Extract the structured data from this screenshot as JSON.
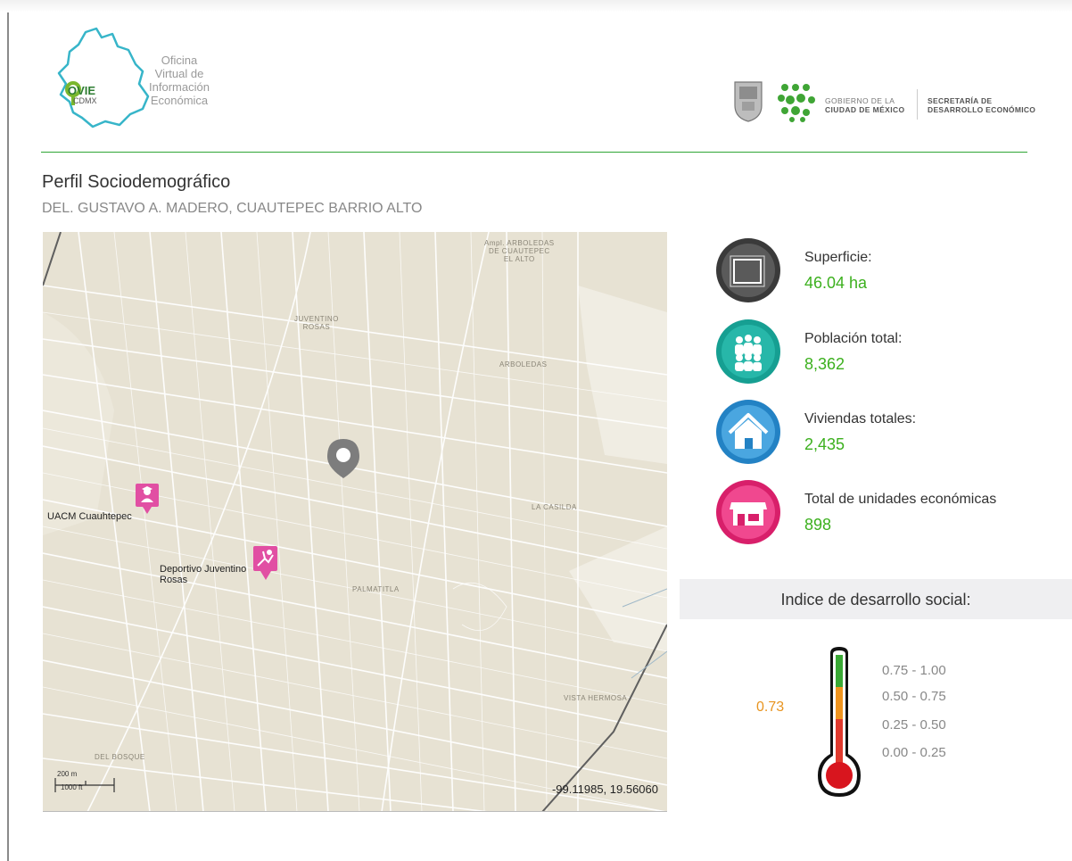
{
  "header": {
    "ovie": {
      "badge_word": "OVIE",
      "badge_sub": "CDMX",
      "lines": [
        "Oficina",
        "Virtual de",
        "Información",
        "Económica"
      ]
    },
    "gov": {
      "line1": "GOBIERNO DE LA",
      "line2": "CIUDAD DE MÉXICO",
      "secretaria_line1": "SECRETARÍA DE",
      "secretaria_line2": "DESARROLLO ECONÓMICO"
    }
  },
  "page": {
    "title": "Perfil Sociodemográfico",
    "subtitle": "DEL. GUSTAVO A. MADERO, CUAUTEPEC BARRIO ALTO"
  },
  "map": {
    "area_labels": {
      "arboledas_cuautepec": [
        "Ampl. ARBOLEDAS",
        "DE CUAUTEPEC",
        "EL ALTO"
      ],
      "juventino": [
        "JUVENTINO",
        "ROSAS"
      ],
      "arboledas": "ARBOLEDAS",
      "la_casilda": "LA CASILDA",
      "palmatitla": "PALMATITLA",
      "vista_hermosa": "VISTA HERMOSA",
      "del_bosque": "DEL BOSQUE"
    },
    "pois": {
      "uacm": "UACM Cuauhtepec",
      "deportivo_line1": "Deportivo Juventino",
      "deportivo_line2": "Rosas"
    },
    "scale_metric": "200 m",
    "scale_imperial": "1000 ft",
    "coordinates": "-99.11985, 19.56060",
    "colors": {
      "land": "#e7e2d3",
      "street": "#ffffff",
      "poi": "#e14fa3",
      "marker": "#7d7d7d"
    }
  },
  "stats": {
    "superficie": {
      "label": "Superficie:",
      "value": "46.04 ha",
      "icon": "area-icon",
      "color": "#444444"
    },
    "poblacion": {
      "label": "Población total:",
      "value": "8,362",
      "icon": "people-icon",
      "color": "#1fa99b"
    },
    "viviendas": {
      "label": "Viviendas totales:",
      "value": "2,435",
      "icon": "house-icon",
      "color": "#2f8fd0"
    },
    "unidades": {
      "label": "Total de unidades económicas",
      "value": "898",
      "icon": "store-icon",
      "color": "#e7357f"
    }
  },
  "ids": {
    "title": "Indice de desarrollo social:",
    "value": "0.73",
    "value_fraction": 0.73,
    "ranges": [
      "0.75 - 1.00",
      "0.50 - 0.75",
      "0.25 - 0.50",
      "0.00 - 0.25"
    ],
    "colors": [
      "#3aa935",
      "#f0951f",
      "#e03a2e",
      "#d8151e"
    ]
  },
  "accent": "#2fa535"
}
